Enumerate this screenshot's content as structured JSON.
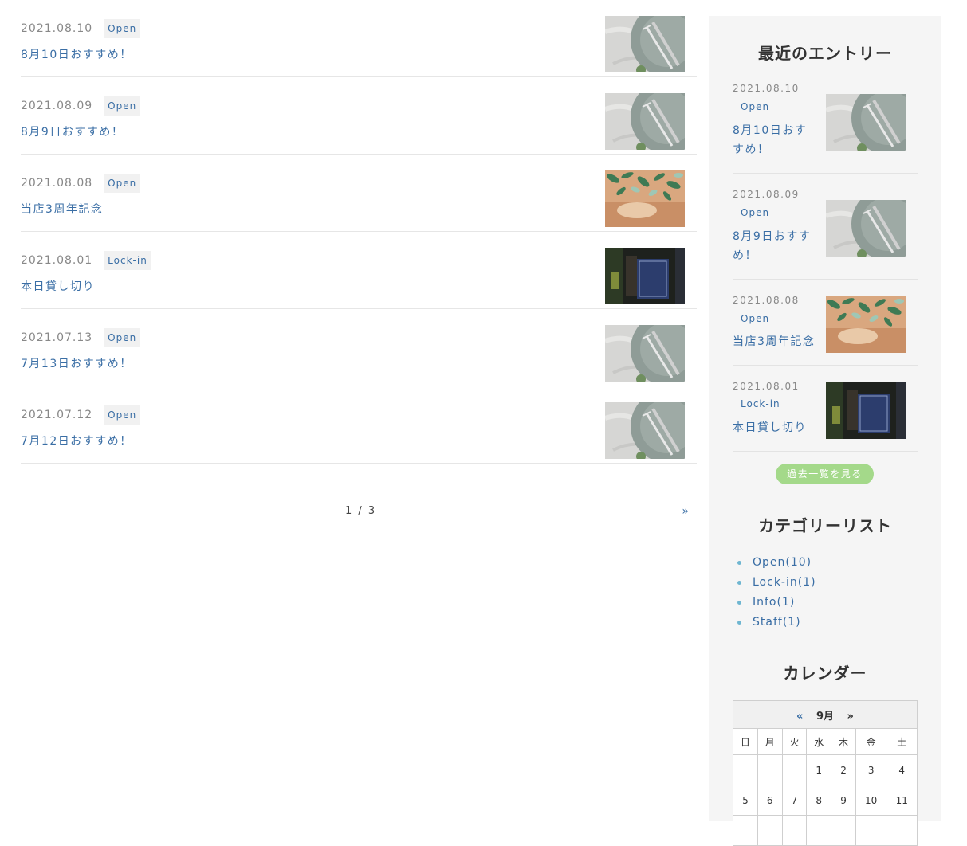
{
  "entries": [
    {
      "date": "2021.08.10",
      "category": "Open",
      "title": "8月10日おすすめ！",
      "thumb": "plate"
    },
    {
      "date": "2021.08.09",
      "category": "Open",
      "title": "8月9日おすすめ！",
      "thumb": "plate"
    },
    {
      "date": "2021.08.08",
      "category": "Open",
      "title": "当店3周年記念",
      "thumb": "leaves"
    },
    {
      "date": "2021.08.01",
      "category": "Lock-in",
      "title": "本日貸し切り",
      "thumb": "closed-sign"
    },
    {
      "date": "2021.07.13",
      "category": "Open",
      "title": "7月13日おすすめ！",
      "thumb": "plate"
    },
    {
      "date": "2021.07.12",
      "category": "Open",
      "title": "7月12日おすすめ！",
      "thumb": "plate"
    }
  ],
  "pager": {
    "current": "1 / 3",
    "next": "»"
  },
  "sidebar": {
    "recent_title": "最近のエントリー",
    "recent": [
      {
        "date": "2021.08.10",
        "category": "Open",
        "title": "8月10日おすすめ！",
        "thumb": "plate"
      },
      {
        "date": "2021.08.09",
        "category": "Open",
        "title": "8月9日おすすめ！",
        "thumb": "plate"
      },
      {
        "date": "2021.08.08",
        "category": "Open",
        "title": "当店3周年記念",
        "thumb": "leaves"
      },
      {
        "date": "2021.08.01",
        "category": "Lock-in",
        "title": "本日貸し切り",
        "thumb": "closed-sign"
      }
    ],
    "more_label": "過去一覧を見る",
    "category_title": "カテゴリーリスト",
    "categories": [
      "Open(10)",
      "Lock-in(1)",
      "Info(1)",
      "Staff(1)"
    ],
    "calendar_title": "カレンダー",
    "calendar": {
      "prev": "«",
      "month": "9月",
      "next": "»",
      "weekdays": [
        "日",
        "月",
        "火",
        "水",
        "木",
        "金",
        "土"
      ],
      "weeks": [
        [
          "",
          "",
          "",
          "1",
          "2",
          "3",
          "4"
        ],
        [
          "5",
          "6",
          "7",
          "8",
          "9",
          "10",
          "11"
        ]
      ]
    }
  },
  "colors": {
    "link": "#3a6ea5",
    "button": "#a4d98a",
    "sidebar_bg": "#f5f5f5"
  }
}
